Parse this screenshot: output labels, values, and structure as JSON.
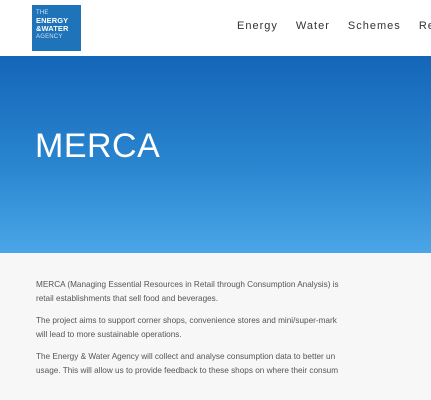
{
  "header": {
    "logo": {
      "line1": "THE",
      "line2": "ENERGY",
      "line3": "&WATER",
      "line4": "AGENCY",
      "color": "#1e73b9"
    },
    "nav": [
      "Energy",
      "Water",
      "Schemes",
      "Res"
    ]
  },
  "hero": {
    "title": "MERCA",
    "color_top": "#1466b8",
    "color_bottom": "#4aa6e6"
  },
  "content": {
    "paragraphs": [
      {
        "lines": [
          "MERCA (Managing Essential Resources in Retail through Consumption Analysis) is",
          "retail establishments that sell food and beverages."
        ]
      },
      {
        "lines": [
          "The project aims to support corner shops, convenience stores and mini/super-mark",
          "will lead to more sustainable operations."
        ]
      },
      {
        "lines": [
          "The Energy & Water Agency will collect and analyse consumption data to better un",
          "usage. This will allow us to provide feedback to these shops on where their consum"
        ]
      }
    ]
  }
}
